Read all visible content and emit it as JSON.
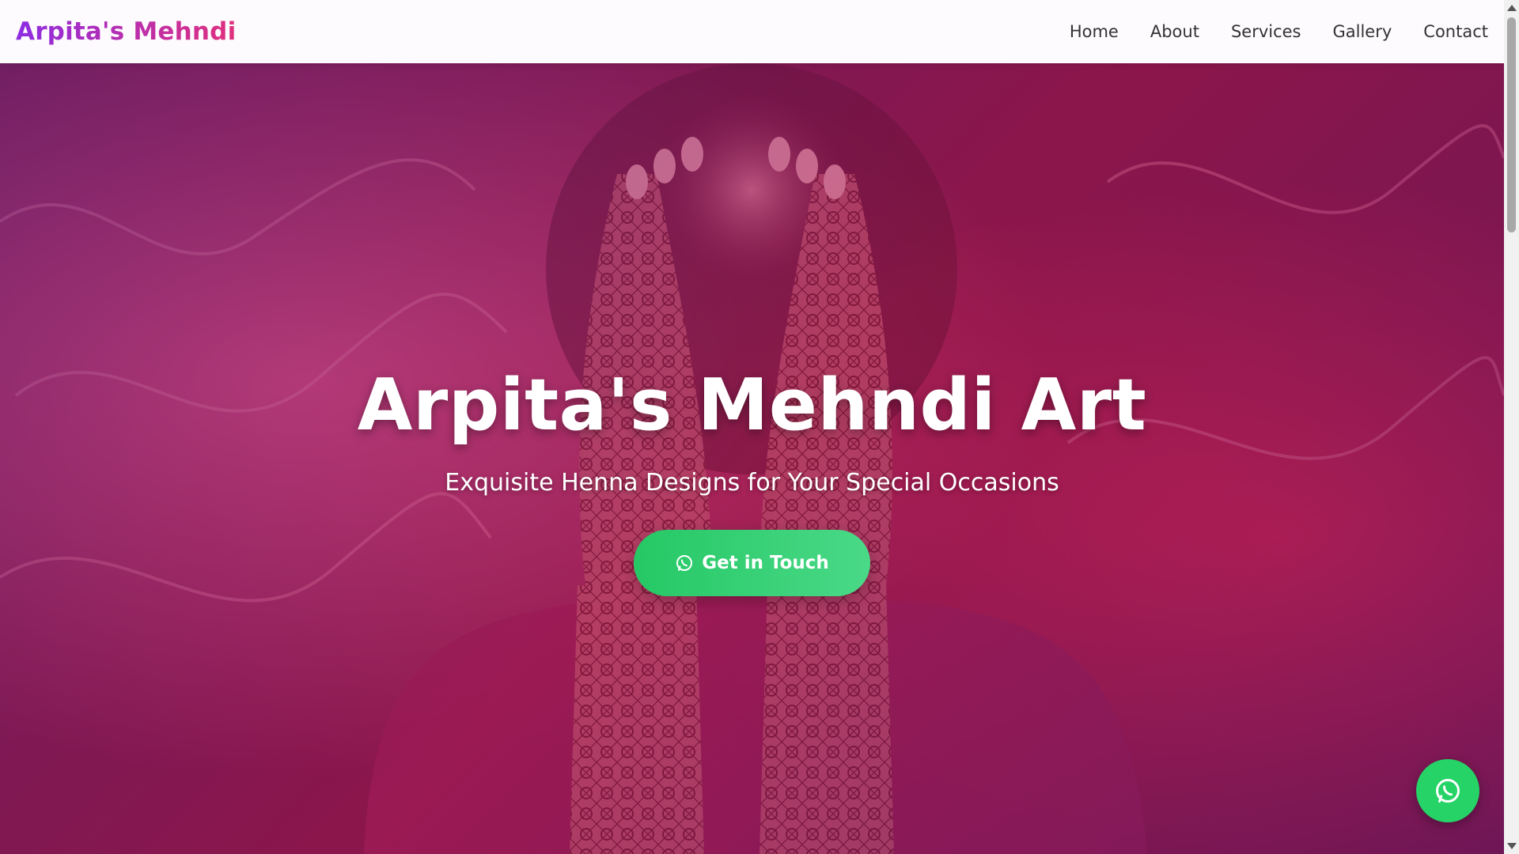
{
  "nav": {
    "brand": "Arpita's Mehndi",
    "links": [
      "Home",
      "About",
      "Services",
      "Gallery",
      "Contact"
    ]
  },
  "hero": {
    "title": "Arpita's Mehndi Art",
    "subtitle": "Exquisite Henna Designs for Your Special Occasions",
    "cta_label": "Get in Touch",
    "cta_icon": "whatsapp-icon"
  },
  "floating_button": {
    "icon": "whatsapp-icon"
  },
  "colors": {
    "brand_gradient_start": "#8e2de2",
    "brand_gradient_end": "#e0307d",
    "cta_green": "#25d366",
    "hero_overlay": "#b01c5a"
  }
}
